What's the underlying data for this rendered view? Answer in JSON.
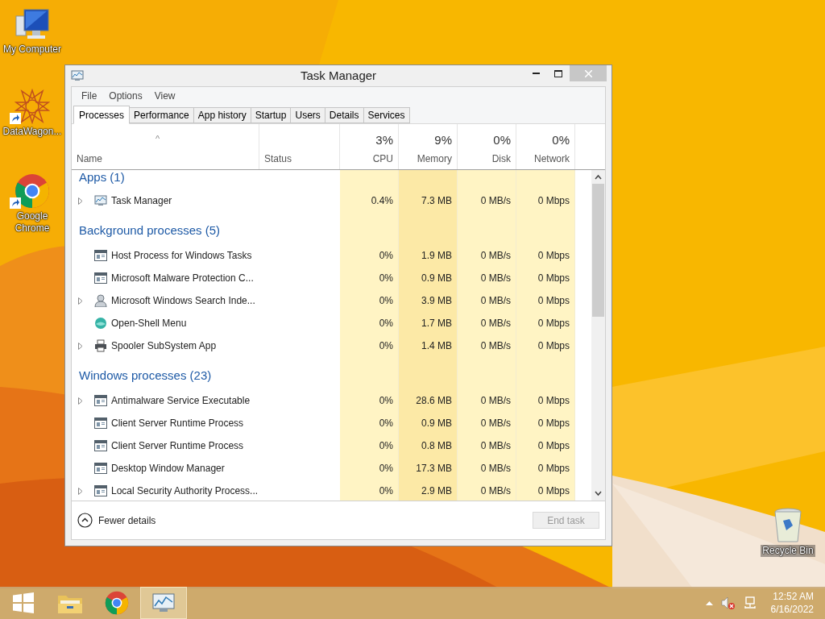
{
  "desktop_icons": [
    {
      "label": "My Computer",
      "kind": "computer",
      "shortcut": false
    },
    {
      "label": "DataWagon...",
      "kind": "star",
      "shortcut": true
    },
    {
      "label": "Google Chrome",
      "kind": "chrome",
      "shortcut": true
    },
    {
      "label": "Recycle Bin",
      "kind": "bin",
      "shortcut": false
    }
  ],
  "window": {
    "title": "Task Manager",
    "menu": [
      "File",
      "Options",
      "View"
    ],
    "tabs": [
      {
        "label": "Processes",
        "selected": true
      },
      {
        "label": "Performance",
        "selected": false
      },
      {
        "label": "App history",
        "selected": false
      },
      {
        "label": "Startup",
        "selected": false
      },
      {
        "label": "Users",
        "selected": false
      },
      {
        "label": "Details",
        "selected": false
      },
      {
        "label": "Services",
        "selected": false
      }
    ],
    "sort_arrow": "^",
    "columns": [
      {
        "label": "Name"
      },
      {
        "label": "Status"
      },
      {
        "percent": "3%",
        "label": "CPU"
      },
      {
        "percent": "9%",
        "label": "Memory"
      },
      {
        "percent": "0%",
        "label": "Disk"
      },
      {
        "percent": "0%",
        "label": "Network"
      }
    ],
    "groups": [
      {
        "title": "Apps (1)",
        "rows": [
          {
            "name": "Task Manager",
            "kind": "taskmgr",
            "expandable": true,
            "cpu": "0.4%",
            "memory": "7.3 MB",
            "disk": "0 MB/s",
            "network": "0 Mbps"
          }
        ]
      },
      {
        "title": "Background processes (5)",
        "rows": [
          {
            "name": "Host Process for Windows Tasks",
            "kind": "window",
            "expandable": false,
            "cpu": "0%",
            "memory": "1.9 MB",
            "disk": "0 MB/s",
            "network": "0 Mbps"
          },
          {
            "name": "Microsoft Malware Protection C...",
            "kind": "window",
            "expandable": false,
            "cpu": "0%",
            "memory": "0.9 MB",
            "disk": "0 MB/s",
            "network": "0 Mbps"
          },
          {
            "name": "Microsoft Windows Search Inde...",
            "kind": "user",
            "expandable": true,
            "cpu": "0%",
            "memory": "3.9 MB",
            "disk": "0 MB/s",
            "network": "0 Mbps"
          },
          {
            "name": "Open-Shell Menu",
            "kind": "shell",
            "expandable": false,
            "cpu": "0%",
            "memory": "1.7 MB",
            "disk": "0 MB/s",
            "network": "0 Mbps"
          },
          {
            "name": "Spooler SubSystem App",
            "kind": "printer",
            "expandable": true,
            "cpu": "0%",
            "memory": "1.4 MB",
            "disk": "0 MB/s",
            "network": "0 Mbps"
          }
        ]
      },
      {
        "title": "Windows processes (23)",
        "rows": [
          {
            "name": "Antimalware Service Executable",
            "kind": "window",
            "expandable": true,
            "cpu": "0%",
            "memory": "28.6 MB",
            "disk": "0 MB/s",
            "network": "0 Mbps"
          },
          {
            "name": "Client Server Runtime Process",
            "kind": "window",
            "expandable": false,
            "cpu": "0%",
            "memory": "0.9 MB",
            "disk": "0 MB/s",
            "network": "0 Mbps"
          },
          {
            "name": "Client Server Runtime Process",
            "kind": "window",
            "expandable": false,
            "cpu": "0%",
            "memory": "0.8 MB",
            "disk": "0 MB/s",
            "network": "0 Mbps"
          },
          {
            "name": "Desktop Window Manager",
            "kind": "window",
            "expandable": false,
            "cpu": "0%",
            "memory": "17.3 MB",
            "disk": "0 MB/s",
            "network": "0 Mbps"
          },
          {
            "name": "Local Security Authority Process...",
            "kind": "window",
            "expandable": true,
            "cpu": "0%",
            "memory": "2.9 MB",
            "disk": "0 MB/s",
            "network": "0 Mbps"
          }
        ]
      }
    ],
    "fewer_details": "Fewer details",
    "end_task": {
      "label": "End task",
      "disabled": true
    }
  },
  "taskbar": {
    "apps": [
      {
        "kind": "start",
        "selected": false
      },
      {
        "kind": "explorer",
        "selected": false
      },
      {
        "kind": "chrome",
        "selected": false
      },
      {
        "kind": "taskmgr",
        "selected": true
      }
    ],
    "time": "12:52 AM",
    "date": "6/16/2022"
  }
}
